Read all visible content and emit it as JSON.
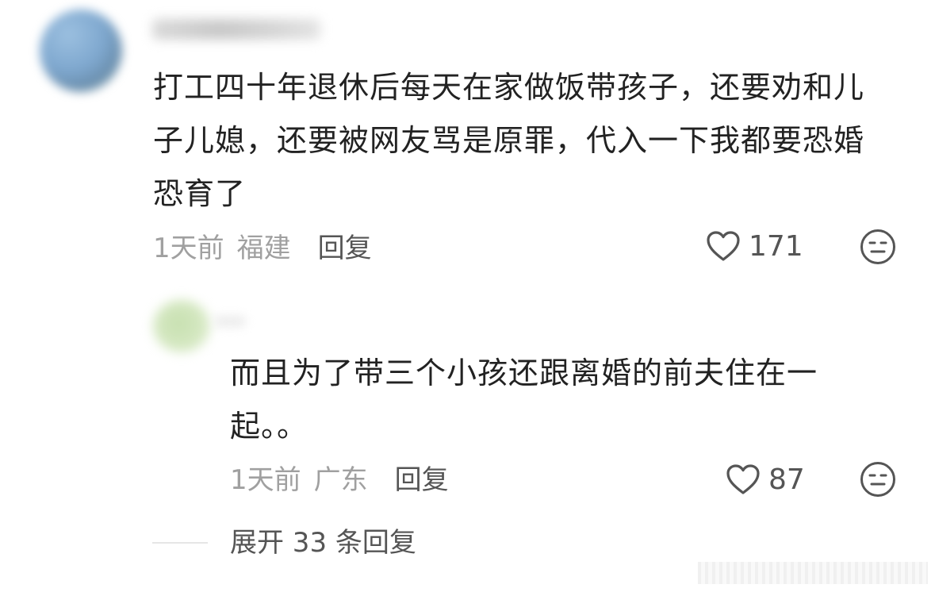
{
  "comment": {
    "text": "打工四十年退休后每天在家做饭带孩子，还要劝和儿子儿媳，还要被网友骂是原罪，代入一下我都要恐婚恐育了",
    "time": "1天前",
    "location": "福建",
    "reply_label": "回复",
    "likes": "171"
  },
  "reply": {
    "text": "而且为了带三个小孩还跟离婚的前夫住在一起。。",
    "time": "1天前",
    "location": "广东",
    "reply_label": "回复",
    "likes": "87"
  },
  "expand_label": "展开 33 条回复",
  "icons": {
    "like": "heart-outline-icon",
    "dislike": "meh-face-icon"
  },
  "colors": {
    "text": "#222222",
    "meta": "#a0a0a0",
    "action": "#555555"
  }
}
